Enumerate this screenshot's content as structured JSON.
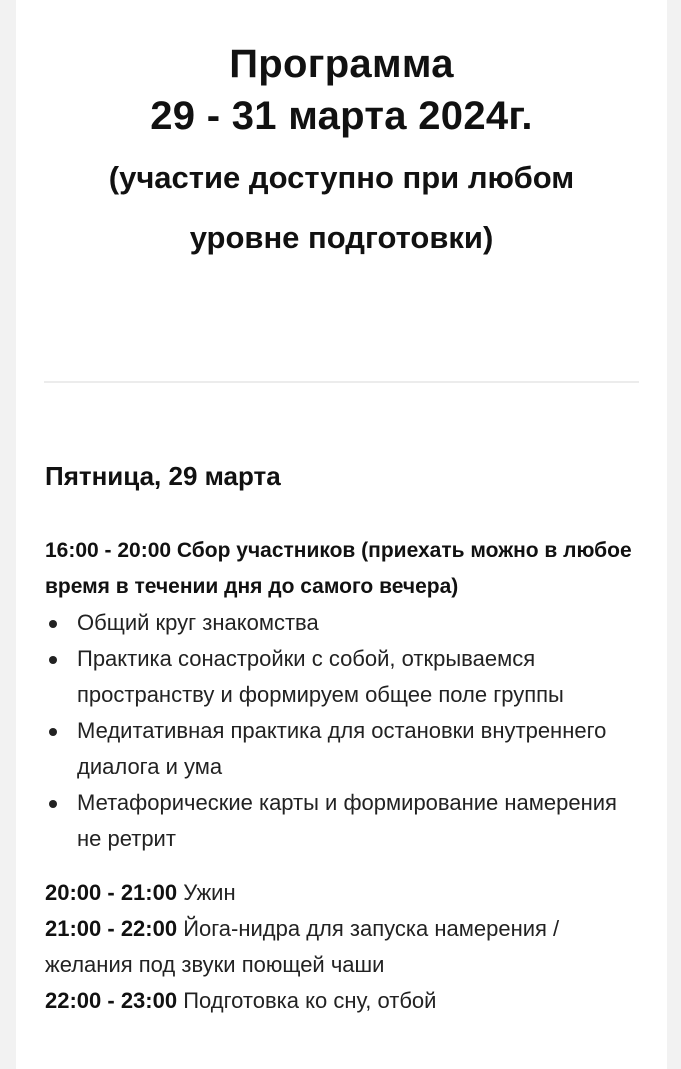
{
  "header": {
    "title": "Программа",
    "dates": "29 - 31 марта 2024г.",
    "note": "(участие доступно при любом уровне подготовки)"
  },
  "day": {
    "heading": "Пятница, 29 марта"
  },
  "session": {
    "title": "16:00 - 20:00 Сбор участников (приехать можно в любое время в течении дня до самого вечера)",
    "items": [
      "Общий круг знакомства",
      "Практика сонастройки с собой, открываемся пространству и формируем общее поле группы",
      "Медитативная практика для остановки внутреннего диалога и ума",
      "Метафорические карты и формирование намерения не ретрит"
    ]
  },
  "evening": [
    {
      "time": "20:00 - 21:00",
      "text": " Ужин"
    },
    {
      "time": "21:00 - 22:00",
      "text": " Йога-нидра для запуска намерения / желания под звуки поющей чаши"
    },
    {
      "time": "22:00 - 23:00",
      "text": " Подготовка ко сну, отбой"
    }
  ]
}
